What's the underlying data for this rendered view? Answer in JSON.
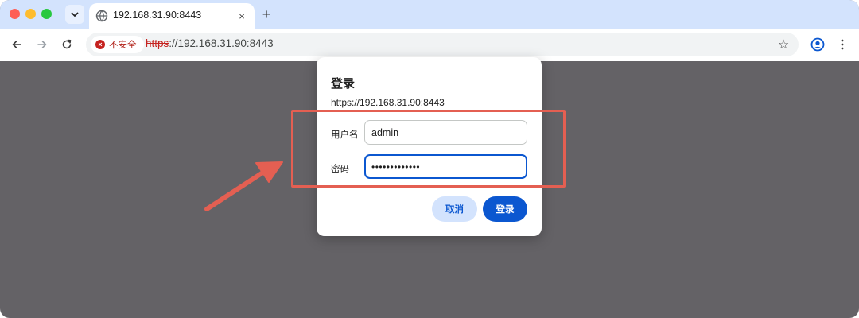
{
  "browser": {
    "tab": {
      "title": "192.168.31.90:8443",
      "close_icon": "×"
    },
    "new_tab_icon": "+",
    "omnibox": {
      "security_label": "不安全",
      "url_scheme": "https",
      "url_rest": "://192.168.31.90:8443"
    }
  },
  "dialog": {
    "title": "登录",
    "origin": "https://192.168.31.90:8443",
    "username_label": "用户名",
    "username_value": "admin",
    "password_label": "密码",
    "password_value": "•••••••••••••",
    "cancel_label": "取消",
    "login_label": "登录"
  },
  "colors": {
    "annotation": "#e45f52",
    "accent": "#0b57d0",
    "overlay": "#646266"
  }
}
